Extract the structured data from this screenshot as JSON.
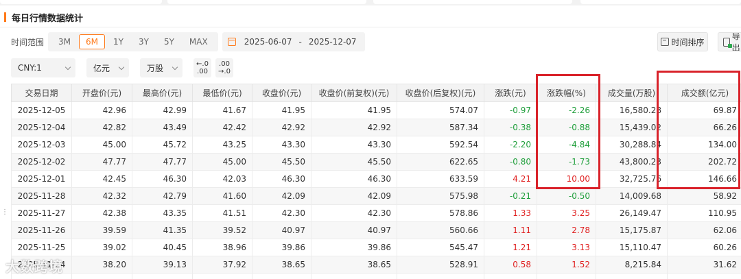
{
  "section": {
    "title": "每日行情数据统计"
  },
  "filters": {
    "range_label": "时间范围",
    "ranges": [
      "3M",
      "6M",
      "1Y",
      "3Y",
      "5Y",
      "MAX"
    ],
    "active_range": "6M",
    "date_start": "2025-06-07",
    "date_sep": "-",
    "date_end": "2025-12-07",
    "sort_label": "时间排序",
    "export_label": "导出",
    "currency": "CNY:1",
    "unit_amount": "亿元",
    "unit_volume": "万股",
    "dec_decrease": {
      "line1": "←.0",
      "line2": ".00"
    },
    "dec_increase": {
      "line1": ".00",
      "line2": "→.0"
    }
  },
  "table": {
    "headers": [
      "交易日期",
      "开盘价(元)",
      "最高价(元)",
      "最低价(元)",
      "收盘价(元)",
      "收盘价(前复权)(元)",
      "收盘价(后复权)(元)",
      "涨跌(元)",
      "涨跌幅(%)",
      "成交量(万股)",
      "成交额(亿元)"
    ],
    "rows": [
      [
        "2025-12-05",
        "42.96",
        "42.99",
        "41.67",
        "41.95",
        "41.95",
        "574.07",
        "-0.97",
        "-2.26",
        "16,580.28",
        "69.87"
      ],
      [
        "2025-12-04",
        "42.82",
        "43.49",
        "42.42",
        "42.92",
        "42.92",
        "587.34",
        "-0.38",
        "-0.88",
        "15,439.02",
        "66.26"
      ],
      [
        "2025-12-03",
        "45.00",
        "45.72",
        "43.25",
        "43.30",
        "43.30",
        "592.54",
        "-2.20",
        "-4.84",
        "30,288.84",
        "134.00"
      ],
      [
        "2025-12-02",
        "47.77",
        "47.77",
        "45.00",
        "45.50",
        "45.50",
        "622.65",
        "-0.80",
        "-1.73",
        "43,800.23",
        "202.72"
      ],
      [
        "2025-12-01",
        "42.45",
        "46.30",
        "42.03",
        "46.30",
        "46.30",
        "633.59",
        "4.21",
        "10.00",
        "32,725.76",
        "146.66"
      ],
      [
        "2025-11-28",
        "42.32",
        "42.79",
        "41.60",
        "42.09",
        "42.09",
        "575.98",
        "-0.21",
        "-0.50",
        "14,009.68",
        "58.92"
      ],
      [
        "2025-11-27",
        "42.38",
        "43.35",
        "41.51",
        "42.30",
        "42.30",
        "578.86",
        "1.33",
        "3.25",
        "26,149.47",
        "110.95"
      ],
      [
        "2025-11-26",
        "39.59",
        "41.35",
        "39.52",
        "40.97",
        "40.97",
        "560.66",
        "1.11",
        "2.78",
        "15,175.87",
        "62.06"
      ],
      [
        "2025-11-25",
        "39.02",
        "40.45",
        "38.96",
        "39.86",
        "39.86",
        "545.47",
        "1.21",
        "3.13",
        "15,110.47",
        "60.26"
      ],
      [
        "2025-11-24",
        "38.20",
        "39.13",
        "37.92",
        "38.65",
        "38.65",
        "528.91",
        "0.58",
        "1.52",
        "8,215.84",
        "31.62"
      ],
      [
        "",
        "",
        "",
        "",
        "",
        "",
        "",
        "",
        "",
        "",
        ""
      ]
    ]
  },
  "colors": {
    "accent": "#ff7a1a",
    "up": "#e02020",
    "down": "#1e9e3a",
    "highlight": "#d9222a"
  },
  "watermark": "大数跨境"
}
